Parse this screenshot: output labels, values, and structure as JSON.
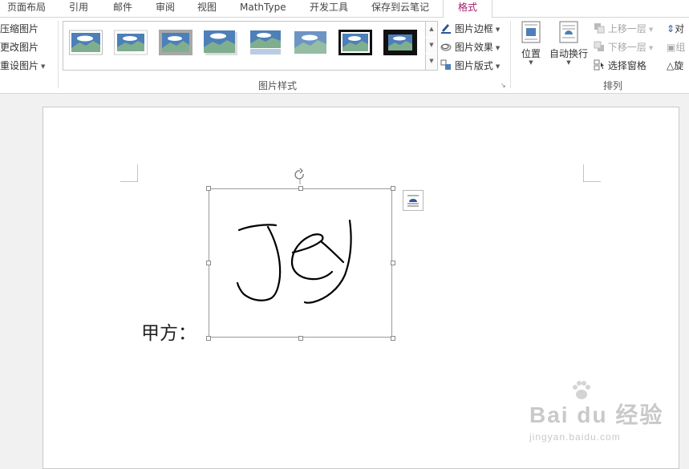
{
  "tabs": [
    {
      "label": "页面布局",
      "active": false
    },
    {
      "label": "引用",
      "active": false
    },
    {
      "label": "邮件",
      "active": false
    },
    {
      "label": "审阅",
      "active": false
    },
    {
      "label": "视图",
      "active": false
    },
    {
      "label": "MathType",
      "active": false
    },
    {
      "label": "开发工具",
      "active": false
    },
    {
      "label": "保存到云笔记",
      "active": false
    },
    {
      "label": "格式",
      "active": true
    }
  ],
  "adjust": {
    "compress": "压缩图片",
    "change": "更改图片",
    "reset": "重设图片"
  },
  "styles": {
    "border": "图片边框",
    "effects": "图片效果",
    "layout": "图片版式",
    "group_label": "图片样式"
  },
  "arrange": {
    "position": "位置",
    "wrap": "自动换行",
    "bring_forward": "上移一层",
    "send_backward": "下移一层",
    "selection_pane": "选择窗格",
    "align": "对",
    "group": "组",
    "rotate": "旋",
    "group_label": "排列"
  },
  "document": {
    "party_label": "甲方："
  },
  "watermark": {
    "brand": "Bai du 经验",
    "url": "jingyan.baidu.com"
  },
  "colors": {
    "active_tab": "#a31b6a",
    "accent_blue": "#2b579a"
  }
}
